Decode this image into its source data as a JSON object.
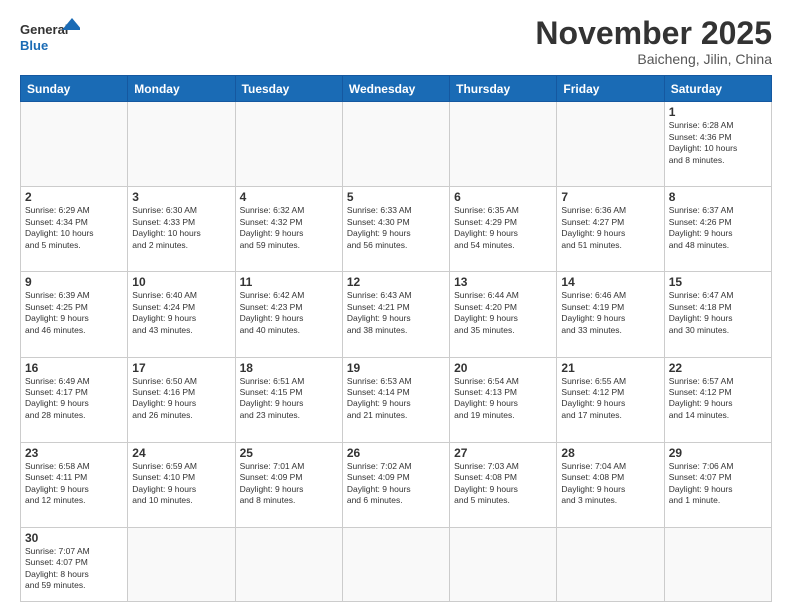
{
  "header": {
    "logo_general": "General",
    "logo_blue": "Blue",
    "month_title": "November 2025",
    "location": "Baicheng, Jilin, China"
  },
  "days_of_week": [
    "Sunday",
    "Monday",
    "Tuesday",
    "Wednesday",
    "Thursday",
    "Friday",
    "Saturday"
  ],
  "weeks": [
    [
      {
        "day": "",
        "info": ""
      },
      {
        "day": "",
        "info": ""
      },
      {
        "day": "",
        "info": ""
      },
      {
        "day": "",
        "info": ""
      },
      {
        "day": "",
        "info": ""
      },
      {
        "day": "",
        "info": ""
      },
      {
        "day": "1",
        "info": "Sunrise: 6:28 AM\nSunset: 4:36 PM\nDaylight: 10 hours\nand 8 minutes."
      }
    ],
    [
      {
        "day": "2",
        "info": "Sunrise: 6:29 AM\nSunset: 4:34 PM\nDaylight: 10 hours\nand 5 minutes."
      },
      {
        "day": "3",
        "info": "Sunrise: 6:30 AM\nSunset: 4:33 PM\nDaylight: 10 hours\nand 2 minutes."
      },
      {
        "day": "4",
        "info": "Sunrise: 6:32 AM\nSunset: 4:32 PM\nDaylight: 9 hours\nand 59 minutes."
      },
      {
        "day": "5",
        "info": "Sunrise: 6:33 AM\nSunset: 4:30 PM\nDaylight: 9 hours\nand 56 minutes."
      },
      {
        "day": "6",
        "info": "Sunrise: 6:35 AM\nSunset: 4:29 PM\nDaylight: 9 hours\nand 54 minutes."
      },
      {
        "day": "7",
        "info": "Sunrise: 6:36 AM\nSunset: 4:27 PM\nDaylight: 9 hours\nand 51 minutes."
      },
      {
        "day": "8",
        "info": "Sunrise: 6:37 AM\nSunset: 4:26 PM\nDaylight: 9 hours\nand 48 minutes."
      }
    ],
    [
      {
        "day": "9",
        "info": "Sunrise: 6:39 AM\nSunset: 4:25 PM\nDaylight: 9 hours\nand 46 minutes."
      },
      {
        "day": "10",
        "info": "Sunrise: 6:40 AM\nSunset: 4:24 PM\nDaylight: 9 hours\nand 43 minutes."
      },
      {
        "day": "11",
        "info": "Sunrise: 6:42 AM\nSunset: 4:23 PM\nDaylight: 9 hours\nand 40 minutes."
      },
      {
        "day": "12",
        "info": "Sunrise: 6:43 AM\nSunset: 4:21 PM\nDaylight: 9 hours\nand 38 minutes."
      },
      {
        "day": "13",
        "info": "Sunrise: 6:44 AM\nSunset: 4:20 PM\nDaylight: 9 hours\nand 35 minutes."
      },
      {
        "day": "14",
        "info": "Sunrise: 6:46 AM\nSunset: 4:19 PM\nDaylight: 9 hours\nand 33 minutes."
      },
      {
        "day": "15",
        "info": "Sunrise: 6:47 AM\nSunset: 4:18 PM\nDaylight: 9 hours\nand 30 minutes."
      }
    ],
    [
      {
        "day": "16",
        "info": "Sunrise: 6:49 AM\nSunset: 4:17 PM\nDaylight: 9 hours\nand 28 minutes."
      },
      {
        "day": "17",
        "info": "Sunrise: 6:50 AM\nSunset: 4:16 PM\nDaylight: 9 hours\nand 26 minutes."
      },
      {
        "day": "18",
        "info": "Sunrise: 6:51 AM\nSunset: 4:15 PM\nDaylight: 9 hours\nand 23 minutes."
      },
      {
        "day": "19",
        "info": "Sunrise: 6:53 AM\nSunset: 4:14 PM\nDaylight: 9 hours\nand 21 minutes."
      },
      {
        "day": "20",
        "info": "Sunrise: 6:54 AM\nSunset: 4:13 PM\nDaylight: 9 hours\nand 19 minutes."
      },
      {
        "day": "21",
        "info": "Sunrise: 6:55 AM\nSunset: 4:12 PM\nDaylight: 9 hours\nand 17 minutes."
      },
      {
        "day": "22",
        "info": "Sunrise: 6:57 AM\nSunset: 4:12 PM\nDaylight: 9 hours\nand 14 minutes."
      }
    ],
    [
      {
        "day": "23",
        "info": "Sunrise: 6:58 AM\nSunset: 4:11 PM\nDaylight: 9 hours\nand 12 minutes."
      },
      {
        "day": "24",
        "info": "Sunrise: 6:59 AM\nSunset: 4:10 PM\nDaylight: 9 hours\nand 10 minutes."
      },
      {
        "day": "25",
        "info": "Sunrise: 7:01 AM\nSunset: 4:09 PM\nDaylight: 9 hours\nand 8 minutes."
      },
      {
        "day": "26",
        "info": "Sunrise: 7:02 AM\nSunset: 4:09 PM\nDaylight: 9 hours\nand 6 minutes."
      },
      {
        "day": "27",
        "info": "Sunrise: 7:03 AM\nSunset: 4:08 PM\nDaylight: 9 hours\nand 5 minutes."
      },
      {
        "day": "28",
        "info": "Sunrise: 7:04 AM\nSunset: 4:08 PM\nDaylight: 9 hours\nand 3 minutes."
      },
      {
        "day": "29",
        "info": "Sunrise: 7:06 AM\nSunset: 4:07 PM\nDaylight: 9 hours\nand 1 minute."
      }
    ],
    [
      {
        "day": "30",
        "info": "Sunrise: 7:07 AM\nSunset: 4:07 PM\nDaylight: 8 hours\nand 59 minutes."
      },
      {
        "day": "",
        "info": ""
      },
      {
        "day": "",
        "info": ""
      },
      {
        "day": "",
        "info": ""
      },
      {
        "day": "",
        "info": ""
      },
      {
        "day": "",
        "info": ""
      },
      {
        "day": "",
        "info": ""
      }
    ]
  ]
}
